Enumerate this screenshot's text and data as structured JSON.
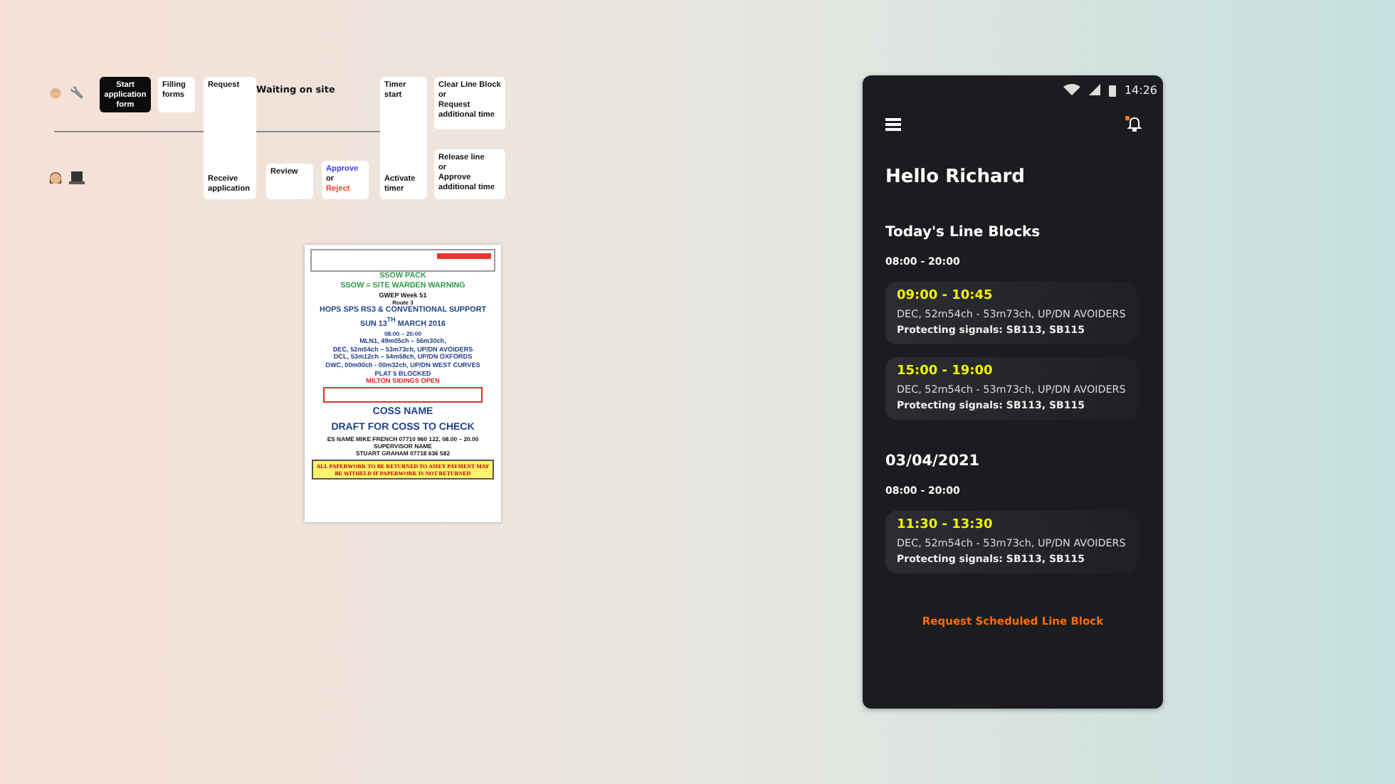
{
  "flow": {
    "cards": [
      {
        "kind": "dark",
        "lines": [
          "Start application form"
        ]
      },
      {
        "kind": "plain",
        "lines": [
          "Filling forms"
        ]
      },
      {
        "kind": "tall",
        "top": "Request",
        "bottom": "Receive application"
      },
      {
        "kind": "waiting",
        "lines": [
          "Waiting on site"
        ]
      },
      {
        "kind": "tall",
        "top": "Timer start",
        "bottom": "Activate timer"
      },
      {
        "kind": "plain",
        "lines": [
          "Clear Line Block",
          "or",
          "Request additional time"
        ]
      },
      {
        "kind": "plain",
        "lines": [
          "Review"
        ]
      },
      {
        "kind": "decision",
        "lines": [
          "Approve",
          "or",
          "Reject"
        ]
      },
      {
        "kind": "plain",
        "lines": [
          "Release line",
          "or",
          "Approve additional time"
        ]
      }
    ]
  },
  "document": {
    "lines": [
      {
        "text": "SSOW PACK",
        "color": "#2e9a4a",
        "kind": "big"
      },
      {
        "text": "SSOW = SITE WARDEN WARNING",
        "color": "#2e9a4a",
        "kind": "big"
      },
      {
        "text": "GWEP Week 51",
        "color": "#111111",
        "kind": "mid"
      },
      {
        "text": "Route 3",
        "color": "#111111",
        "kind": "tiny"
      },
      {
        "text": "HOPS SPS RS3 & CONVENTIONAL SUPPORT",
        "color": "#1f3f8a",
        "kind": "big"
      },
      {
        "text": "SUN 13$^{TH}$ MARCH 2016",
        "color": "#1f3f8a",
        "kind": "big"
      },
      {
        "text": "08:00 – 20:00",
        "color": "#1f3f8a",
        "kind": "small"
      },
      {
        "text": "MLN1, 49m05ch – 56m30ch,",
        "color": "#1f3f8a",
        "kind": "mid"
      },
      {
        "text": "DEC, 52m54ch – 53m73ch, UP/DN AVOIDERS",
        "color": "#1f3f8a",
        "kind": "mid"
      },
      {
        "text": "DCL, 53m12ch – 54m58ch, UP/DN OXFORDS",
        "color": "#1f3f8a",
        "kind": "mid"
      },
      {
        "text": "DWC, 00m00ch - 00m32ch, UP/DN WEST CURVES",
        "color": "#1f3f8a",
        "kind": "mid"
      },
      {
        "text": "PLAT 5 BLOCKED",
        "color": "#1f3f8a",
        "kind": "mid"
      },
      {
        "text": "MILTON SIDINGS OPEN",
        "color": "#e02020",
        "kind": "mid"
      },
      {
        "text": "COSS NAME",
        "color": "#1f3f8a",
        "kind": "huge"
      },
      {
        "text": "DRAFT FOR COSS TO CHECK",
        "color": "#1f3f8a",
        "kind": "huge"
      },
      {
        "text": "ES NAME MIKE FRENCH  07710 960 122, 08.00 – 20.00",
        "color": "#111111",
        "kind": "small"
      },
      {
        "text": "SUPERVISOR NAME",
        "color": "#111111",
        "kind": "small"
      },
      {
        "text": "STUART GRAHAM 07718 636 582",
        "color": "#111111",
        "kind": "small"
      }
    ],
    "notice": "ALL PAPERWORK TO BE RETURNED TO AMEY PAYMENT MAY BE WITHELD IF PAPERWORK IS NOT RETURNED"
  },
  "phone": {
    "time": "14:26",
    "notification_unread": true,
    "greeting": "Hello Richard",
    "heading": "Today's Line Blocks",
    "sections": [
      {
        "window": "08:00 - 20:00",
        "blocks": [
          {
            "time": "09:00 - 10:45",
            "location": "DEC, 52m54ch - 53m73ch, UP/DN AVOIDERS",
            "signals": "Protecting signals: SB113, SB115"
          },
          {
            "time": "15:00 - 19:00",
            "location": "DEC, 52m54ch - 53m73ch, UP/DN AVOIDERS",
            "signals": "Protecting signals: SB113, SB115"
          }
        ]
      },
      {
        "title": "03/04/2021",
        "window": "08:00 - 20:00",
        "blocks": [
          {
            "time": "11:30 - 13:30",
            "location": "DEC, 52m54ch - 53m73ch, UP/DN AVOIDERS",
            "signals": "Protecting signals: SB113, SB115"
          }
        ]
      }
    ],
    "action": "Request Scheduled Line Block"
  }
}
